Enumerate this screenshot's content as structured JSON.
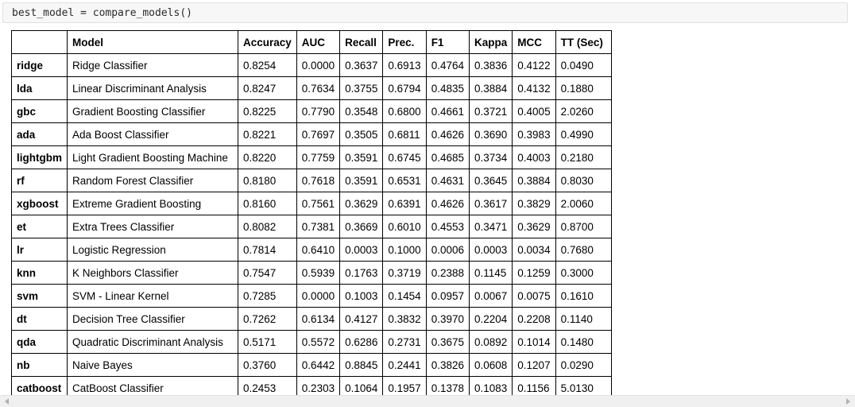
{
  "code_cell": {
    "source": "best_model = compare_models()"
  },
  "table": {
    "index_header": "",
    "columns": [
      "Model",
      "Accuracy",
      "AUC",
      "Recall",
      "Prec.",
      "F1",
      "Kappa",
      "MCC",
      "TT (Sec)"
    ],
    "rows": [
      {
        "id": "ridge",
        "model": "Ridge Classifier",
        "accuracy": "0.8254",
        "auc": "0.0000",
        "recall": "0.3637",
        "prec": "0.6913",
        "f1": "0.4764",
        "kappa": "0.3836",
        "mcc": "0.4122",
        "tt": "0.0490"
      },
      {
        "id": "lda",
        "model": "Linear Discriminant Analysis",
        "accuracy": "0.8247",
        "auc": "0.7634",
        "recall": "0.3755",
        "prec": "0.6794",
        "f1": "0.4835",
        "kappa": "0.3884",
        "mcc": "0.4132",
        "tt": "0.1880"
      },
      {
        "id": "gbc",
        "model": "Gradient Boosting Classifier",
        "accuracy": "0.8225",
        "auc": "0.7790",
        "recall": "0.3548",
        "prec": "0.6800",
        "f1": "0.4661",
        "kappa": "0.3721",
        "mcc": "0.4005",
        "tt": "2.0260"
      },
      {
        "id": "ada",
        "model": "Ada Boost Classifier",
        "accuracy": "0.8221",
        "auc": "0.7697",
        "recall": "0.3505",
        "prec": "0.6811",
        "f1": "0.4626",
        "kappa": "0.3690",
        "mcc": "0.3983",
        "tt": "0.4990"
      },
      {
        "id": "lightgbm",
        "model": "Light Gradient Boosting Machine",
        "accuracy": "0.8220",
        "auc": "0.7759",
        "recall": "0.3591",
        "prec": "0.6745",
        "f1": "0.4685",
        "kappa": "0.3734",
        "mcc": "0.4003",
        "tt": "0.2180"
      },
      {
        "id": "rf",
        "model": "Random Forest Classifier",
        "accuracy": "0.8180",
        "auc": "0.7618",
        "recall": "0.3591",
        "prec": "0.6531",
        "f1": "0.4631",
        "kappa": "0.3645",
        "mcc": "0.3884",
        "tt": "0.8030"
      },
      {
        "id": "xgboost",
        "model": "Extreme Gradient Boosting",
        "accuracy": "0.8160",
        "auc": "0.7561",
        "recall": "0.3629",
        "prec": "0.6391",
        "f1": "0.4626",
        "kappa": "0.3617",
        "mcc": "0.3829",
        "tt": "2.0060"
      },
      {
        "id": "et",
        "model": "Extra Trees Classifier",
        "accuracy": "0.8082",
        "auc": "0.7381",
        "recall": "0.3669",
        "prec": "0.6010",
        "f1": "0.4553",
        "kappa": "0.3471",
        "mcc": "0.3629",
        "tt": "0.8700"
      },
      {
        "id": "lr",
        "model": "Logistic Regression",
        "accuracy": "0.7814",
        "auc": "0.6410",
        "recall": "0.0003",
        "prec": "0.1000",
        "f1": "0.0006",
        "kappa": "0.0003",
        "mcc": "0.0034",
        "tt": "0.7680"
      },
      {
        "id": "knn",
        "model": "K Neighbors Classifier",
        "accuracy": "0.7547",
        "auc": "0.5939",
        "recall": "0.1763",
        "prec": "0.3719",
        "f1": "0.2388",
        "kappa": "0.1145",
        "mcc": "0.1259",
        "tt": "0.3000"
      },
      {
        "id": "svm",
        "model": "SVM - Linear Kernel",
        "accuracy": "0.7285",
        "auc": "0.0000",
        "recall": "0.1003",
        "prec": "0.1454",
        "f1": "0.0957",
        "kappa": "0.0067",
        "mcc": "0.0075",
        "tt": "0.1610"
      },
      {
        "id": "dt",
        "model": "Decision Tree Classifier",
        "accuracy": "0.7262",
        "auc": "0.6134",
        "recall": "0.4127",
        "prec": "0.3832",
        "f1": "0.3970",
        "kappa": "0.2204",
        "mcc": "0.2208",
        "tt": "0.1140"
      },
      {
        "id": "qda",
        "model": "Quadratic Discriminant Analysis",
        "accuracy": "0.5171",
        "auc": "0.5572",
        "recall": "0.6286",
        "prec": "0.2731",
        "f1": "0.3675",
        "kappa": "0.0892",
        "mcc": "0.1014",
        "tt": "0.1480"
      },
      {
        "id": "nb",
        "model": "Naive Bayes",
        "accuracy": "0.3760",
        "auc": "0.6442",
        "recall": "0.8845",
        "prec": "0.2441",
        "f1": "0.3826",
        "kappa": "0.0608",
        "mcc": "0.1207",
        "tt": "0.0290"
      },
      {
        "id": "catboost",
        "model": "CatBoost Classifier",
        "accuracy": "0.2453",
        "auc": "0.2303",
        "recall": "0.1064",
        "prec": "0.1957",
        "f1": "0.1378",
        "kappa": "0.1083",
        "mcc": "0.1156",
        "tt": "5.0130"
      }
    ]
  },
  "scrollbar": {
    "left_arrow": "◀",
    "right_arrow": "▶"
  }
}
